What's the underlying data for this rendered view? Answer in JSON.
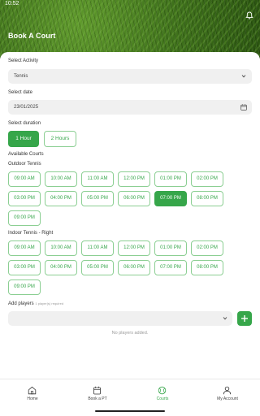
{
  "status_bar": {
    "time": "10:52"
  },
  "header": {
    "title": "Book A Court"
  },
  "activity": {
    "label": "Select Activity",
    "value": "Tennis"
  },
  "date": {
    "label": "Select date",
    "value": "23/01/2025"
  },
  "duration": {
    "label": "Select duration",
    "options": [
      "1 Hour",
      "2 Hours"
    ],
    "selected": "1 Hour"
  },
  "courts": {
    "heading": "Available Courts",
    "sections": [
      {
        "name": "Outdoor Tennis",
        "slots": [
          "09:00 AM",
          "10:00 AM",
          "11:00 AM",
          "12:00 PM",
          "01:00 PM",
          "02:00 PM",
          "03:00 PM",
          "04:00 PM",
          "05:00 PM",
          "06:00 PM",
          "07:00 PM",
          "08:00 PM",
          "09:00 PM"
        ],
        "selected": "07:00 PM"
      },
      {
        "name": "Indoor Tennis - Right",
        "slots": [
          "09:00 AM",
          "10:00 AM",
          "11:00 AM",
          "12:00 PM",
          "01:00 PM",
          "02:00 PM",
          "03:00 PM",
          "04:00 PM",
          "05:00 PM",
          "06:00 PM",
          "07:00 PM",
          "08:00 PM",
          "09:00 PM"
        ],
        "selected": null
      }
    ]
  },
  "players": {
    "label": "Add players",
    "hint": "1 player(s) required",
    "empty_text": "No players added."
  },
  "nav": {
    "items": [
      {
        "label": "Home",
        "icon": "home-icon"
      },
      {
        "label": "Book a PT",
        "icon": "calendar-icon"
      },
      {
        "label": "Courts",
        "icon": "tennis-ball-icon"
      },
      {
        "label": "My Account",
        "icon": "user-icon"
      }
    ],
    "active": "Courts"
  },
  "colors": {
    "accent": "#36a64a",
    "field_bg": "#f0f0f0"
  }
}
